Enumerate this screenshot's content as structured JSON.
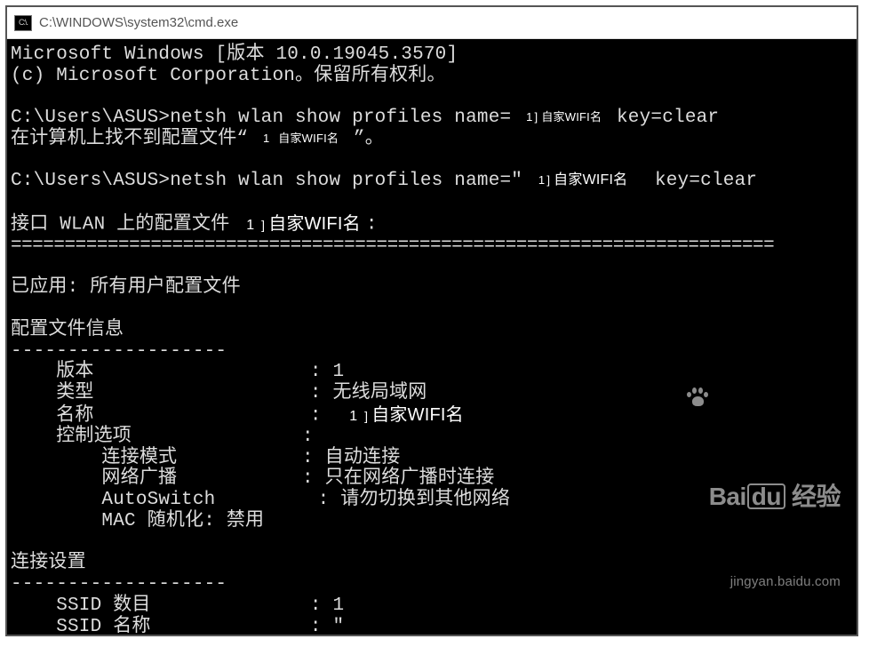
{
  "window": {
    "title": "C:\\WINDOWS\\system32\\cmd.exe",
    "icon_label": "C:\\."
  },
  "terminal": {
    "header_line1": "Microsoft Windows [版本 10.0.19045.3570]",
    "header_line2": "(c) Microsoft Corporation。保留所有权利。",
    "prompt1_prefix": "C:\\Users\\ASUS>",
    "cmd1_before": "netsh wlan show profiles name=",
    "cmd1_after": " key=clear",
    "redact_small_num": "1",
    "redact_small_bracket": "]",
    "redact_text": "自家WIFI名",
    "not_found_before": "在计算机上找不到配置文件“",
    "not_found_after": "”。",
    "prompt2_prefix": "C:\\Users\\ASUS>",
    "cmd2_before": "netsh wlan show profiles name=\"",
    "cmd2_after": " key=clear",
    "interface_before": "接口 WLAN 上的配置文件",
    "interface_after": ":",
    "divider": "=======================================================================",
    "applied": "已应用: 所有用户配置文件",
    "profile_info_title": "配置文件信息",
    "dashes": "-------------------",
    "version_label": "    版本                   : ",
    "version_value": "1",
    "type_label": "    类型                   : ",
    "type_value": "无线局域网",
    "name_label": "    名称                   : ",
    "control_label": "    控制选项               :",
    "connmode_label": "        连接模式           : ",
    "connmode_value": "自动连接",
    "broadcast_label": "        网络广播           : ",
    "broadcast_value": "只在网络广播时连接",
    "autoswitch_label": "        AutoSwitch         : ",
    "autoswitch_value": "请勿切换到其他网络",
    "macrand_label": "        MAC 随机化: ",
    "macrand_value": "禁用",
    "conn_settings_title": "连接设置",
    "ssid_count_label": "    SSID 数目              : ",
    "ssid_count_value": "1",
    "ssid_name_label": "    SSID 名称              : ",
    "ssid_name_value": "\""
  },
  "watermark": {
    "brand_en": "Bai",
    "brand_du": "du",
    "brand_cn": "经验",
    "url": "jingyan.baidu.com"
  }
}
